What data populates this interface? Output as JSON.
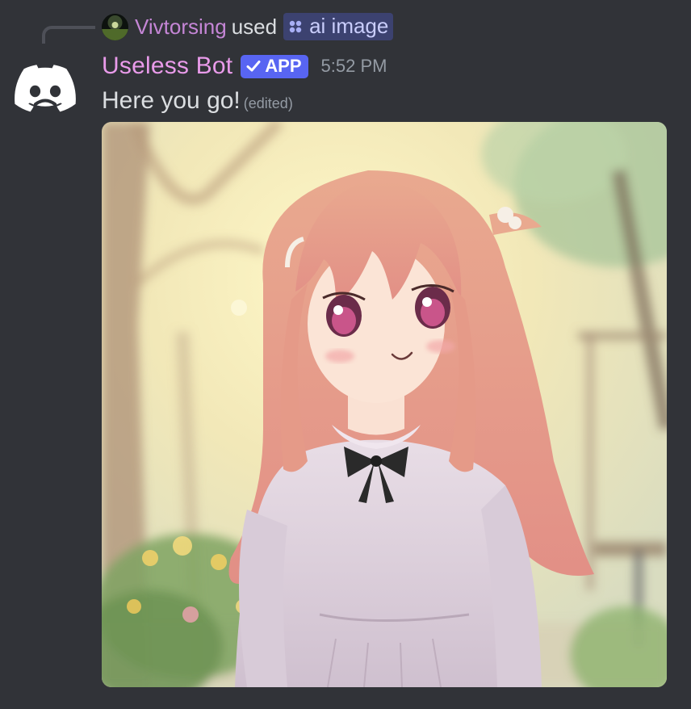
{
  "interaction": {
    "user_name": "Vivtorsing",
    "used_text": "used",
    "command_name": "ai image"
  },
  "message": {
    "author": "Useless Bot",
    "badge": "APP",
    "timestamp": "5:52 PM",
    "content": "Here you go!",
    "edited_label": "(edited)"
  },
  "attachment": {
    "kind": "image",
    "icon": "generated-anime-girl-image"
  },
  "colors": {
    "background": "#313338",
    "user_name": "#c586d6",
    "bot_name": "#e99bea",
    "app_badge": "#5865f2",
    "command_pill": "#3c4270",
    "timestamp": "#949ba4",
    "text": "#dbdee1"
  }
}
